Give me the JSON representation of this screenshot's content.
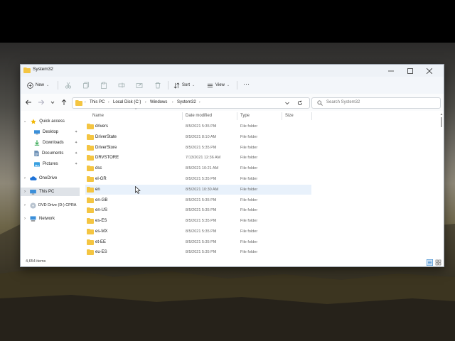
{
  "window": {
    "title": "System32"
  },
  "toolbar": {
    "new_label": "New",
    "sort_label": "Sort",
    "view_label": "View"
  },
  "address": {
    "crumbs": [
      "This PC",
      "Local Disk (C:)",
      "Windows",
      "System32"
    ]
  },
  "search": {
    "placeholder": "Search System32"
  },
  "sidebar": {
    "items": [
      {
        "label": "Quick access"
      },
      {
        "label": "Desktop"
      },
      {
        "label": "Downloads"
      },
      {
        "label": "Documents"
      },
      {
        "label": "Pictures"
      },
      {
        "label": "OneDrive"
      },
      {
        "label": "This PC"
      },
      {
        "label": "DVD Drive (D:) CPRA"
      },
      {
        "label": "Network"
      }
    ]
  },
  "columns": {
    "name": "Name",
    "date": "Date modified",
    "type": "Type",
    "size": "Size"
  },
  "files": [
    {
      "name": "drivers",
      "date": "8/5/2021 5:35 PM",
      "type": "File folder"
    },
    {
      "name": "DriverState",
      "date": "8/5/2021 8:10 AM",
      "type": "File folder"
    },
    {
      "name": "DriverStore",
      "date": "8/5/2021 5:35 PM",
      "type": "File folder"
    },
    {
      "name": "DRVSTORE",
      "date": "7/13/2021 12:36 AM",
      "type": "File folder"
    },
    {
      "name": "dsc",
      "date": "8/5/2021 10:21 AM",
      "type": "File folder"
    },
    {
      "name": "el-GR",
      "date": "8/5/2021 5:35 PM",
      "type": "File folder"
    },
    {
      "name": "en",
      "date": "8/5/2021 10:30 AM",
      "type": "File folder"
    },
    {
      "name": "en-GB",
      "date": "8/5/2021 5:35 PM",
      "type": "File folder"
    },
    {
      "name": "en-US",
      "date": "8/5/2021 5:35 PM",
      "type": "File folder"
    },
    {
      "name": "es-ES",
      "date": "8/5/2021 5:35 PM",
      "type": "File folder"
    },
    {
      "name": "es-MX",
      "date": "8/5/2021 5:35 PM",
      "type": "File folder"
    },
    {
      "name": "et-EE",
      "date": "8/5/2021 5:35 PM",
      "type": "File folder"
    },
    {
      "name": "eu-ES",
      "date": "8/5/2021 5:35 PM",
      "type": "File folder"
    }
  ],
  "status": {
    "item_count": "4,654 items"
  },
  "colors": {
    "folder": "#f4c542",
    "accent": "#0067c0",
    "hover_row": "#e8f1fb"
  }
}
